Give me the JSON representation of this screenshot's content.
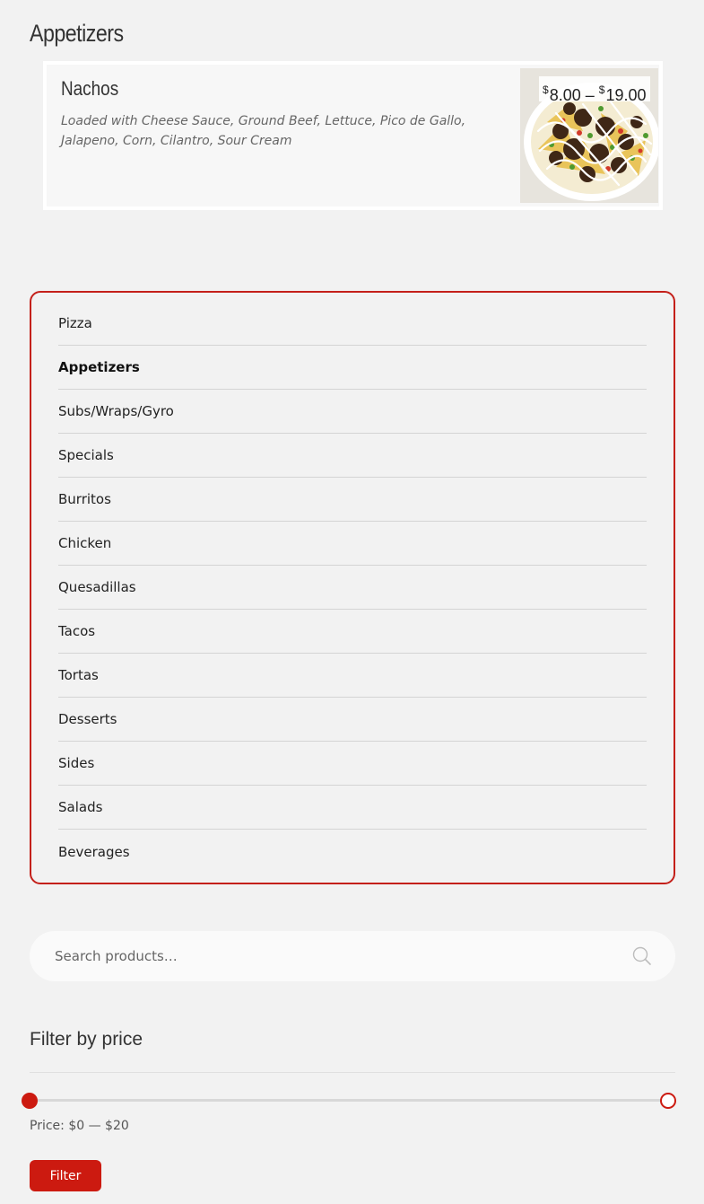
{
  "section": {
    "title": "Appetizers"
  },
  "product": {
    "name": "Nachos",
    "description": "Loaded with Cheese Sauce, Ground Beef, Lettuce, Pico de Gallo, Jalapeno, Corn, Cilantro, Sour Cream",
    "price_currency": "$",
    "price_min": "8.00",
    "price_sep": "–",
    "price_max": "19.00"
  },
  "categories": {
    "items": [
      {
        "label": "Pizza"
      },
      {
        "label": "Appetizers",
        "active": true
      },
      {
        "label": "Subs/Wraps/Gyro"
      },
      {
        "label": "Specials"
      },
      {
        "label": "Burritos"
      },
      {
        "label": "Chicken"
      },
      {
        "label": "Quesadillas"
      },
      {
        "label": "Tacos"
      },
      {
        "label": "Tortas"
      },
      {
        "label": "Desserts"
      },
      {
        "label": "Sides"
      },
      {
        "label": "Salads"
      },
      {
        "label": "Beverages"
      }
    ]
  },
  "search": {
    "placeholder": "Search products…",
    "icon": "search-icon"
  },
  "price_filter": {
    "title": "Filter by price",
    "price_label": "Price: $0 — $20",
    "min_value": 0,
    "max_value": 20,
    "range_min": 0,
    "range_max": 20,
    "button_label": "Filter"
  },
  "colors": {
    "accent": "#cc1a10",
    "background": "#f2f2f2"
  }
}
